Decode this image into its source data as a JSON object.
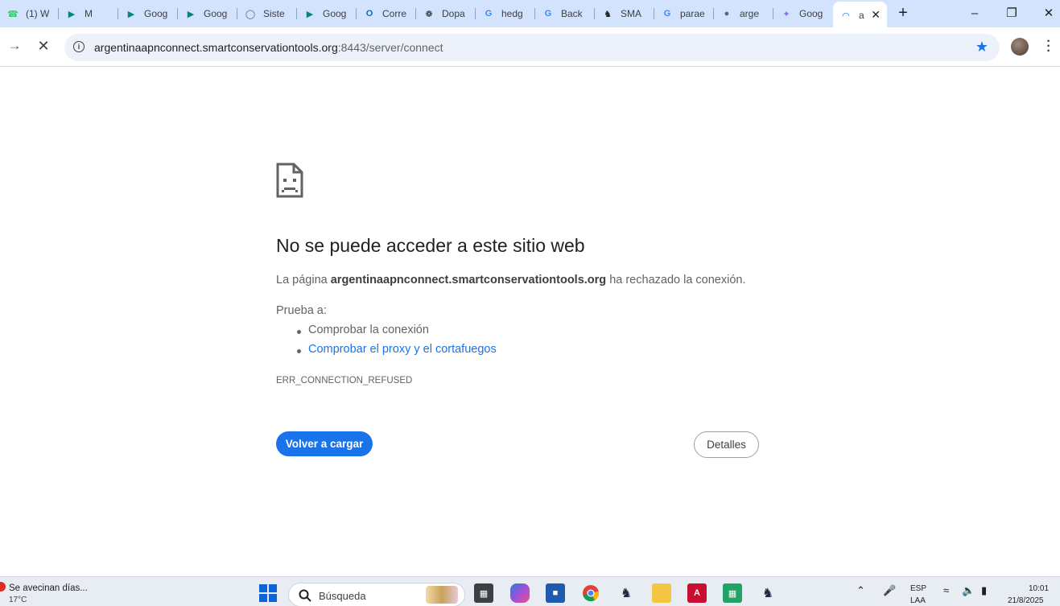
{
  "browser": {
    "tabs": [
      {
        "title": "(1) W",
        "icon": "whatsapp-icon",
        "color": "#25d366"
      },
      {
        "title": "M",
        "icon": "meet-icon",
        "color": "#00897b"
      },
      {
        "title": "Goog",
        "icon": "meet-icon",
        "color": "#00897b"
      },
      {
        "title": "Goog",
        "icon": "meet-icon",
        "color": "#00897b"
      },
      {
        "title": "Siste",
        "icon": "government-icon",
        "color": "#5f6368"
      },
      {
        "title": "Goog",
        "icon": "meet-icon",
        "color": "#00897b"
      },
      {
        "title": "Corre",
        "icon": "outlook-icon",
        "color": "#0f6cbd"
      },
      {
        "title": "Dopa",
        "icon": "openai-icon",
        "color": "#202124"
      },
      {
        "title": "hedg",
        "icon": "google-icon",
        "color": "#4285f4"
      },
      {
        "title": "Back",
        "icon": "google-icon",
        "color": "#4285f4"
      },
      {
        "title": "SMA",
        "icon": "smart-icon",
        "color": "#202124"
      },
      {
        "title": "parae",
        "icon": "google-icon",
        "color": "#4285f4"
      },
      {
        "title": "arge",
        "icon": "globe-icon",
        "color": "#5f6368"
      },
      {
        "title": "Goog",
        "icon": "gemini-icon",
        "color": "#8e6cf0"
      },
      {
        "title": "a",
        "icon": "loading-icon",
        "color": "#1a73e8",
        "active": true
      }
    ],
    "url_host": "argentinaapnconnect.smartconservationtools.org",
    "url_path": ":8443/server/connect"
  },
  "page": {
    "heading": "No se puede acceder a este sitio web",
    "desc_prefix": "La página ",
    "desc_host": "argentinaapnconnect.smartconservationtools.org",
    "desc_suffix": " ha rechazado la conexión.",
    "try_label": "Prueba a:",
    "suggestion_1": "Comprobar la conexión",
    "suggestion_2": "Comprobar el proxy y el cortafuegos",
    "error_code": "ERR_CONNECTION_REFUSED",
    "reload_label": "Volver a cargar",
    "details_label": "Detalles"
  },
  "taskbar": {
    "weather_text": "Se avecinan días...",
    "weather_temp": "17°C",
    "search_placeholder": "Búsqueda",
    "lang_line1": "ESP",
    "lang_line2": "LAA",
    "time": "10:01",
    "date": "21/8/2025"
  }
}
